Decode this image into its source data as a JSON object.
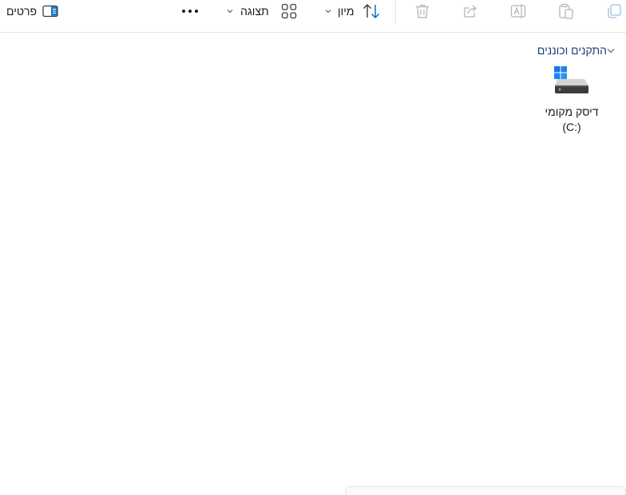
{
  "toolbar": {
    "details_label": "פרטים",
    "view_label": "תצוגה",
    "sort_label": "מיון"
  },
  "group": {
    "label": "התקנים וכוננים"
  },
  "drives": [
    {
      "name": "דיסק מקומי",
      "letter": "(C:)"
    }
  ],
  "icons": {
    "details": "details-pane-icon",
    "more": "more-options-icon",
    "view": "view-grid-icon",
    "sort": "sort-icon",
    "delete": "delete-icon",
    "share": "share-icon",
    "rename": "rename-icon",
    "paste": "paste-icon",
    "copy": "copy-icon",
    "drive": "local-disk-icon"
  },
  "colors": {
    "accent": "#0067c0",
    "group_text": "#1f3a7a",
    "disabled": "#b5b5b5"
  }
}
